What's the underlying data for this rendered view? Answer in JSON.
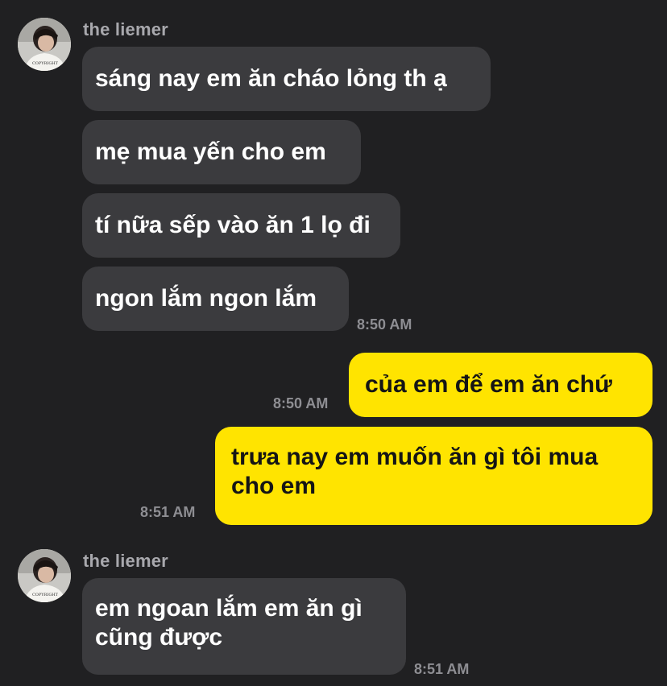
{
  "chat": {
    "contact_name": "the liemer",
    "avatar_shirt_text": "COPYRIGHT",
    "groups": [
      {
        "sender": "the liemer",
        "messages": [
          "sáng nay em ăn cháo lỏng th ạ",
          "mẹ mua yến cho em",
          "tí nữa sếp vào ăn 1 lọ đi",
          "ngon lắm ngon lắm"
        ],
        "time": "8:50 AM"
      },
      {
        "sender": "me",
        "messages": [
          "của em để em ăn chứ"
        ],
        "time": "8:50 AM"
      },
      {
        "sender": "me",
        "messages": [
          "trưa nay em muốn ăn gì tôi mua cho em"
        ],
        "time": "8:51 AM"
      },
      {
        "sender": "the liemer",
        "messages": [
          "em ngoan lắm em ăn gì cũng được"
        ],
        "time": "8:51 AM"
      }
    ]
  },
  "colors": {
    "background": "#202022",
    "incoming_bubble": "#3b3b3e",
    "outgoing_bubble": "#ffe400",
    "timestamp": "#8e8e93",
    "sender_name": "#a8a8ad"
  }
}
